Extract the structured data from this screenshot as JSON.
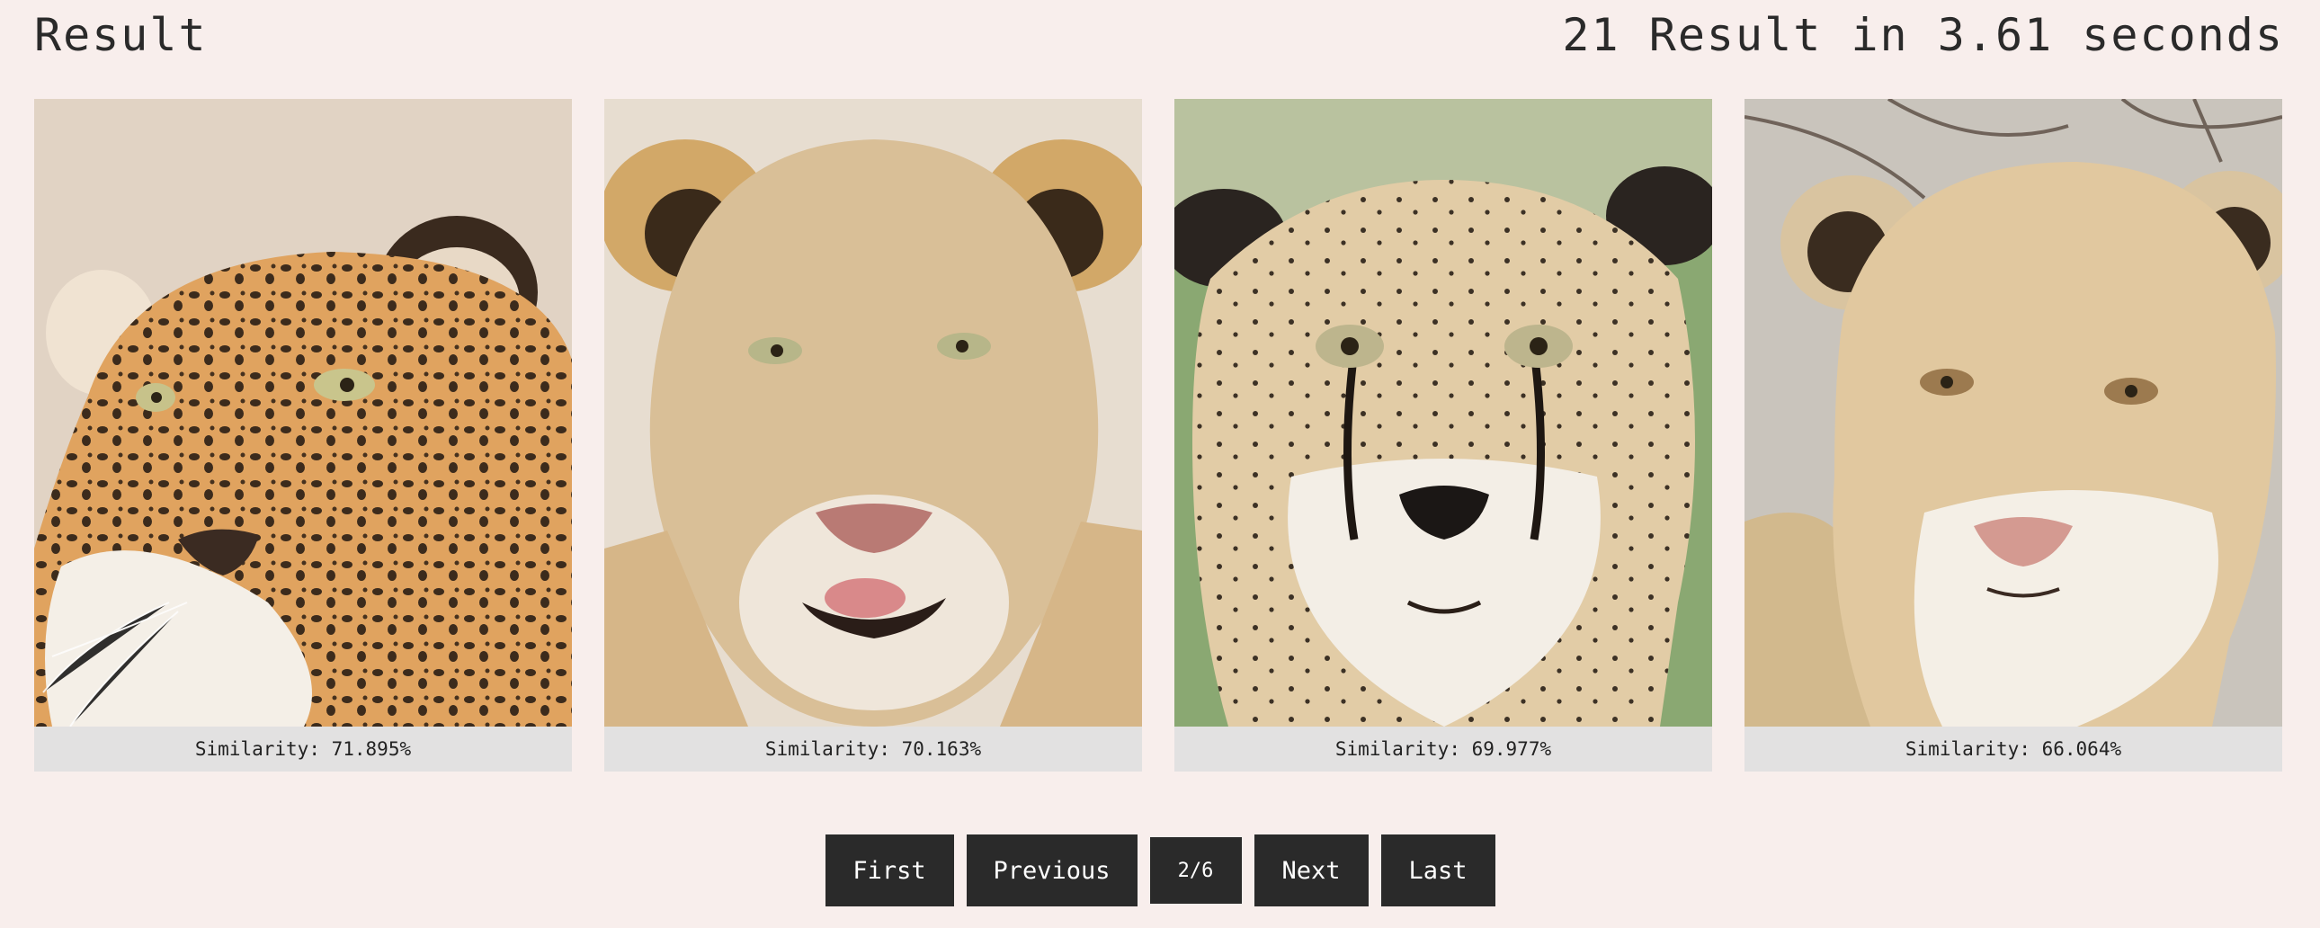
{
  "header": {
    "title": "Result",
    "summary": "21 Result in 3.61 seconds"
  },
  "results": [
    {
      "image_icon": "leopard-face-image",
      "caption": "Similarity: 71.895%"
    },
    {
      "image_icon": "lioness-face-image",
      "caption": "Similarity: 70.163%"
    },
    {
      "image_icon": "cheetah-face-image",
      "caption": "Similarity: 69.977%"
    },
    {
      "image_icon": "white-lioness-face-image",
      "caption": "Similarity: 66.064%"
    }
  ],
  "pagination": {
    "first": "First",
    "previous": "Previous",
    "page_indicator": "2/6",
    "next": "Next",
    "last": "Last"
  },
  "colors": {
    "background": "#f8eeec",
    "button": "#2a2a2a",
    "caption_bg": "#e2e1e1"
  }
}
